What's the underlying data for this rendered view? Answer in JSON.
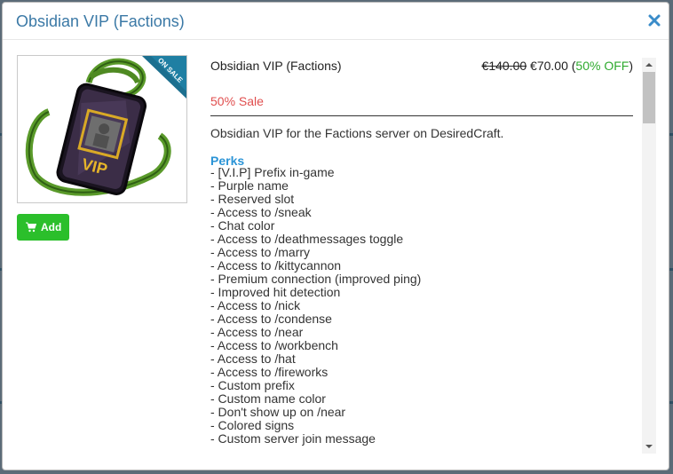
{
  "modal": {
    "title": "Obsidian VIP (Factions)",
    "close_icon": "close-icon"
  },
  "product": {
    "image_icon": "vip-lanyard-badge-image",
    "ribbon_text": "ON SALE",
    "badge_text": "VIP",
    "name": "Obsidian VIP (Factions)",
    "old_price": "€140.00",
    "new_price": "€70.00",
    "discount_open": "(",
    "discount": "50% OFF",
    "discount_close": ")",
    "sale_label": "50% Sale",
    "description": "Obsidian VIP for the Factions server on DesiredCraft."
  },
  "add_button": {
    "label": "Add",
    "icon": "cart-icon"
  },
  "perks": {
    "heading": "Perks",
    "items": [
      "- [V.I.P] Prefix in-game",
      "- Purple name",
      "- Reserved slot",
      "- Access to /sneak",
      "- Chat color",
      "- Access to /deathmessages toggle",
      "- Access to /marry",
      "- Access to /kittycannon",
      "- Premium connection (improved ping)",
      "- Improved hit detection",
      "- Access to /nick",
      "- Access to /condense",
      "- Access to /near",
      "- Access to /workbench",
      "- Access to /hat",
      "- Access to /fireworks",
      "- Custom prefix",
      "- Custom name color",
      "- Don't show up on /near",
      "- Colored signs",
      "- Custom server join message"
    ]
  },
  "colors": {
    "title": "#3b79a6",
    "sale": "#e04e4e",
    "discount": "#2eaa2e",
    "perks_heading": "#2b94d6",
    "add_button": "#2bbf2b"
  }
}
